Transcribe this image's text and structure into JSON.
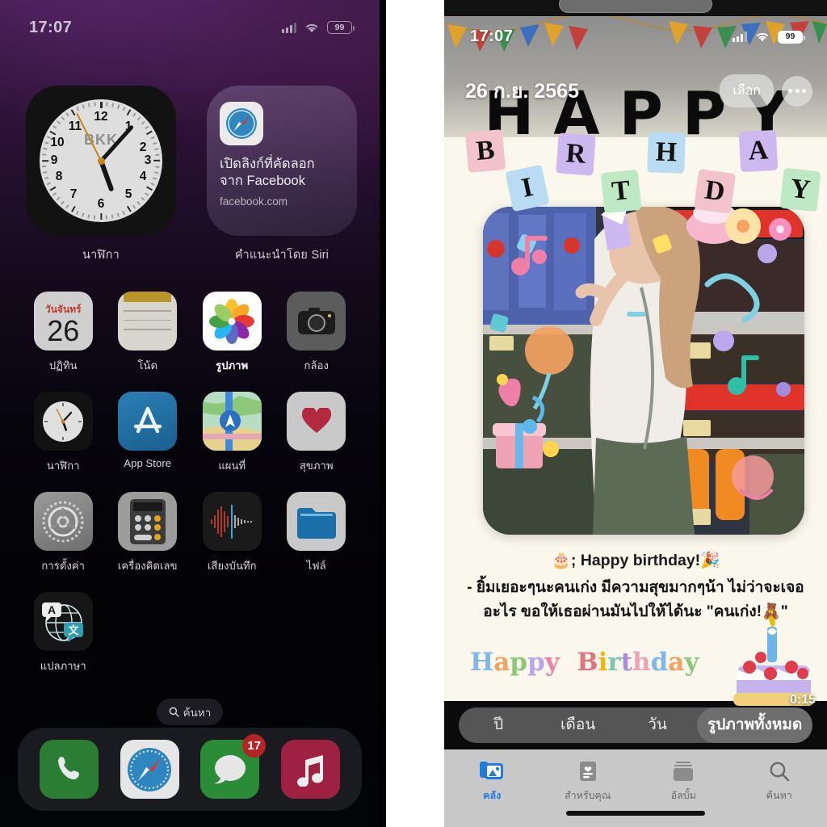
{
  "home_screen": {
    "status_bar": {
      "time": "17:07",
      "battery": "99",
      "cellular_icon": "cellular-bars-icon",
      "wifi_icon": "wifi-icon"
    },
    "widgets": [
      {
        "type": "clock",
        "city": "BKK",
        "label": "นาฬิกา",
        "numbers": [
          "12",
          "1",
          "2",
          "3",
          "4",
          "5",
          "6",
          "7",
          "8",
          "9",
          "10",
          "11"
        ]
      },
      {
        "type": "siri_suggestion",
        "icon": "safari-icon",
        "title": "เปิดลิงก์ที่คัดลอก\nจาก Facebook",
        "title_line1": "เปิดลิงก์ที่คัดลอก",
        "title_line2": "จาก Facebook",
        "subtitle": "facebook.com",
        "label": "คำแนะนำโดย Siri"
      }
    ],
    "apps": [
      {
        "label": "ปฏิทิน",
        "icon": "calendar-icon",
        "day_name": "วันจันทร์",
        "day_number": "26"
      },
      {
        "label": "โน้ต",
        "icon": "notes-icon"
      },
      {
        "label": "รูปภาพ",
        "icon": "photos-icon",
        "highlighted": true
      },
      {
        "label": "กล้อง",
        "icon": "camera-icon"
      },
      {
        "label": "นาฬิกา",
        "icon": "clock-icon"
      },
      {
        "label": "App Store",
        "icon": "app-store-icon"
      },
      {
        "label": "แผนที่",
        "icon": "maps-icon"
      },
      {
        "label": "สุขภาพ",
        "icon": "health-icon"
      },
      {
        "label": "การตั้งค่า",
        "icon": "settings-icon"
      },
      {
        "label": "เครื่องคิดเลข",
        "icon": "calculator-icon"
      },
      {
        "label": "เสียงบันทึก",
        "icon": "voice-memos-icon"
      },
      {
        "label": "ไฟล์",
        "icon": "files-icon"
      },
      {
        "label": "แปลภาษา",
        "icon": "translate-icon"
      }
    ],
    "search": {
      "label": "ค้นหา",
      "icon": "search-icon"
    },
    "dock": [
      {
        "name": "phone",
        "icon": "phone-icon"
      },
      {
        "name": "safari",
        "icon": "safari-icon"
      },
      {
        "name": "messages",
        "icon": "messages-icon",
        "badge": "17"
      },
      {
        "name": "music",
        "icon": "music-icon"
      }
    ]
  },
  "photos_app": {
    "status_bar": {
      "time": "17:07",
      "battery": "99"
    },
    "navbar": {
      "date": "26 ก.ย. 2565",
      "select_label": "เลือก",
      "more_icon": "ellipsis-icon"
    },
    "decor": {
      "happy_letters": [
        "H",
        "A",
        "P",
        "P",
        "Y"
      ],
      "birthday_letters": [
        "B",
        "I",
        "R",
        "T",
        "H",
        "D",
        "A",
        "Y"
      ]
    },
    "photo": {
      "caption_line1": "🎂; Happy birthday!🎉",
      "caption_line2": "- ยิ้มเยอะๆนะคนเก่ง มีความสุขมากๆน้า ไม่ว่าจะเจอ",
      "caption_line3": "อะไร ขอให้เธอผ่านมันไปให้ได้นะ \"คนเก่ง!🧸\"",
      "script_text": "Happy Birthday",
      "duration": "0:15"
    },
    "segmented_control": {
      "options": [
        "ปี",
        "เดือน",
        "วัน",
        "รูปภาพทั้งหมด"
      ],
      "selected": "รูปภาพทั้งหมด"
    },
    "tab_bar": [
      {
        "label": "คลัง",
        "icon": "library-icon",
        "active": true
      },
      {
        "label": "สำหรับคุณ",
        "icon": "for-you-icon",
        "active": false
      },
      {
        "label": "อัลบั้ม",
        "icon": "albums-icon",
        "active": false
      },
      {
        "label": "ค้นหา",
        "icon": "search-icon",
        "active": false
      }
    ]
  },
  "colors": {
    "accent_blue": "#1f7ce0",
    "badge_red": "#b32424",
    "photos_bg": "#faf7ec"
  }
}
